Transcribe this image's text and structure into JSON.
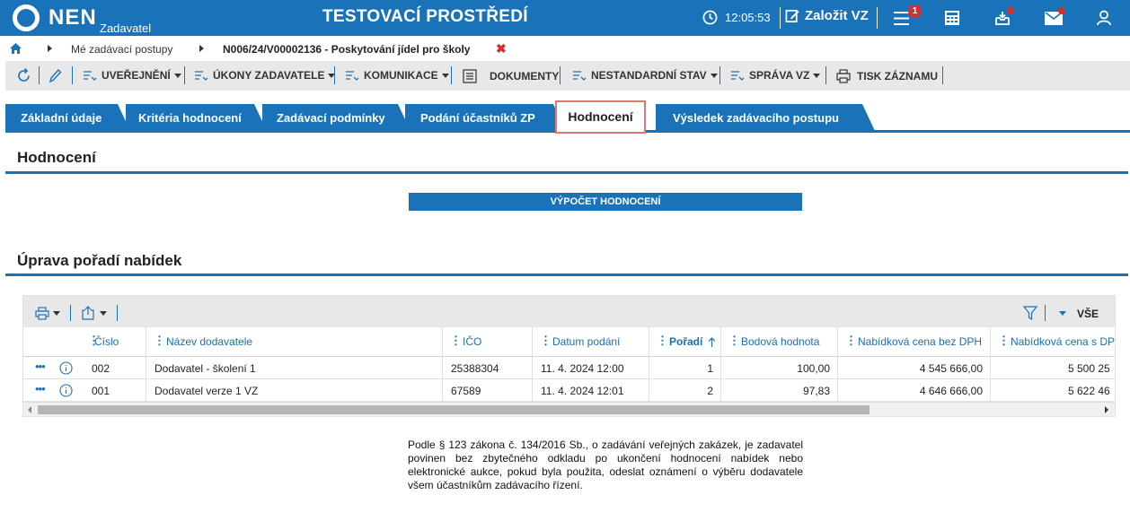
{
  "app": {
    "logo_text": "NEN",
    "logo_sub": "Zadavatel",
    "env_title": "TESTOVACÍ PROSTŘEDÍ",
    "clock": "12:05:53",
    "create_label": "Založit VZ",
    "menu_badge": "1"
  },
  "breadcrumb": {
    "item1": "Mé zadávací postupy",
    "item2": "N006/24/V00002136 - Poskytování jídel pro školy",
    "close": "✖"
  },
  "toolbar": {
    "publish": "UVEŘEJNĚNÍ",
    "acts": "ÚKONY ZADAVATELE",
    "communication": "KOMUNIKACE",
    "documents": "DOKUMENTY",
    "nonstandard": "NESTANDARDNÍ STAV",
    "management": "SPRÁVA VZ",
    "print": "TISK ZÁZNAMU"
  },
  "tabs": [
    "Základní údaje",
    "Kritéria hodnocení",
    "Zadávací podmínky",
    "Podání účastníků ZP",
    "Hodnocení",
    "Výsledek zadávacího postupu"
  ],
  "section1": {
    "title": "Hodnocení",
    "button": "VÝPOČET HODNOCENÍ"
  },
  "section2": {
    "title": "Úprava pořadí nabídek",
    "filter_all": "VŠE"
  },
  "grid": {
    "columns": [
      "Číslo",
      "Název dodavatele",
      "IČO",
      "Datum podání",
      "Pořadí",
      "Bodová hodnota",
      "Nabídková cena bez DPH",
      "Nabídková cena s DP"
    ],
    "rows": [
      {
        "num": "002",
        "name": "Dodavatel - školení 1",
        "ico": "25388304",
        "date": "11. 4. 2024 12:00",
        "rank": "1",
        "score": "100,00",
        "price": "4 545 666,00",
        "price_vat": "5 500 25"
      },
      {
        "num": "001",
        "name": "Dodavatel verze 1 VZ",
        "ico": "67589",
        "date": "11. 4. 2024 12:01",
        "rank": "2",
        "score": "97,83",
        "price": "4 646 666,00",
        "price_vat": "5 622 46"
      }
    ]
  },
  "legal_text": "Podle § 123 zákona č. 134/2016 Sb., o zadávání veřejných zakázek, je zadavatel povinen bez zbytečného odkladu po ukončení hodnocení nabídek nebo elektronické aukce, pokud byla použita, odeslat oznámení o výběru dodavatele všem účastníkům zadávacího řízení.",
  "colors": {
    "primary": "#1a73b8",
    "alert": "#d32f2f",
    "active_tab_border": "#e57373"
  }
}
